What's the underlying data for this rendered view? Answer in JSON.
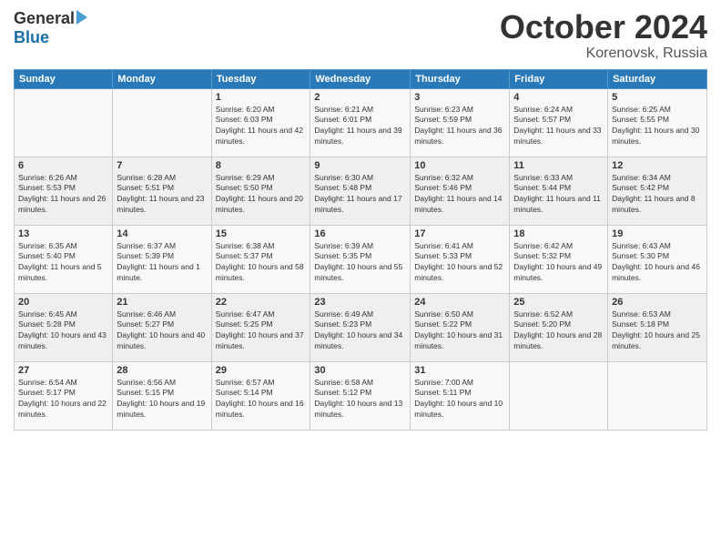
{
  "header": {
    "logo_general": "General",
    "logo_blue": "Blue",
    "month": "October 2024",
    "location": "Korenovsk, Russia"
  },
  "weekdays": [
    "Sunday",
    "Monday",
    "Tuesday",
    "Wednesday",
    "Thursday",
    "Friday",
    "Saturday"
  ],
  "weeks": [
    [
      {
        "day": "",
        "info": ""
      },
      {
        "day": "",
        "info": ""
      },
      {
        "day": "1",
        "info": "Sunrise: 6:20 AM\nSunset: 6:03 PM\nDaylight: 11 hours and 42 minutes."
      },
      {
        "day": "2",
        "info": "Sunrise: 6:21 AM\nSunset: 6:01 PM\nDaylight: 11 hours and 39 minutes."
      },
      {
        "day": "3",
        "info": "Sunrise: 6:23 AM\nSunset: 5:59 PM\nDaylight: 11 hours and 36 minutes."
      },
      {
        "day": "4",
        "info": "Sunrise: 6:24 AM\nSunset: 5:57 PM\nDaylight: 11 hours and 33 minutes."
      },
      {
        "day": "5",
        "info": "Sunrise: 6:25 AM\nSunset: 5:55 PM\nDaylight: 11 hours and 30 minutes."
      }
    ],
    [
      {
        "day": "6",
        "info": "Sunrise: 6:26 AM\nSunset: 5:53 PM\nDaylight: 11 hours and 26 minutes."
      },
      {
        "day": "7",
        "info": "Sunrise: 6:28 AM\nSunset: 5:51 PM\nDaylight: 11 hours and 23 minutes."
      },
      {
        "day": "8",
        "info": "Sunrise: 6:29 AM\nSunset: 5:50 PM\nDaylight: 11 hours and 20 minutes."
      },
      {
        "day": "9",
        "info": "Sunrise: 6:30 AM\nSunset: 5:48 PM\nDaylight: 11 hours and 17 minutes."
      },
      {
        "day": "10",
        "info": "Sunrise: 6:32 AM\nSunset: 5:46 PM\nDaylight: 11 hours and 14 minutes."
      },
      {
        "day": "11",
        "info": "Sunrise: 6:33 AM\nSunset: 5:44 PM\nDaylight: 11 hours and 11 minutes."
      },
      {
        "day": "12",
        "info": "Sunrise: 6:34 AM\nSunset: 5:42 PM\nDaylight: 11 hours and 8 minutes."
      }
    ],
    [
      {
        "day": "13",
        "info": "Sunrise: 6:35 AM\nSunset: 5:40 PM\nDaylight: 11 hours and 5 minutes."
      },
      {
        "day": "14",
        "info": "Sunrise: 6:37 AM\nSunset: 5:39 PM\nDaylight: 11 hours and 1 minute."
      },
      {
        "day": "15",
        "info": "Sunrise: 6:38 AM\nSunset: 5:37 PM\nDaylight: 10 hours and 58 minutes."
      },
      {
        "day": "16",
        "info": "Sunrise: 6:39 AM\nSunset: 5:35 PM\nDaylight: 10 hours and 55 minutes."
      },
      {
        "day": "17",
        "info": "Sunrise: 6:41 AM\nSunset: 5:33 PM\nDaylight: 10 hours and 52 minutes."
      },
      {
        "day": "18",
        "info": "Sunrise: 6:42 AM\nSunset: 5:32 PM\nDaylight: 10 hours and 49 minutes."
      },
      {
        "day": "19",
        "info": "Sunrise: 6:43 AM\nSunset: 5:30 PM\nDaylight: 10 hours and 46 minutes."
      }
    ],
    [
      {
        "day": "20",
        "info": "Sunrise: 6:45 AM\nSunset: 5:28 PM\nDaylight: 10 hours and 43 minutes."
      },
      {
        "day": "21",
        "info": "Sunrise: 6:46 AM\nSunset: 5:27 PM\nDaylight: 10 hours and 40 minutes."
      },
      {
        "day": "22",
        "info": "Sunrise: 6:47 AM\nSunset: 5:25 PM\nDaylight: 10 hours and 37 minutes."
      },
      {
        "day": "23",
        "info": "Sunrise: 6:49 AM\nSunset: 5:23 PM\nDaylight: 10 hours and 34 minutes."
      },
      {
        "day": "24",
        "info": "Sunrise: 6:50 AM\nSunset: 5:22 PM\nDaylight: 10 hours and 31 minutes."
      },
      {
        "day": "25",
        "info": "Sunrise: 6:52 AM\nSunset: 5:20 PM\nDaylight: 10 hours and 28 minutes."
      },
      {
        "day": "26",
        "info": "Sunrise: 6:53 AM\nSunset: 5:18 PM\nDaylight: 10 hours and 25 minutes."
      }
    ],
    [
      {
        "day": "27",
        "info": "Sunrise: 6:54 AM\nSunset: 5:17 PM\nDaylight: 10 hours and 22 minutes."
      },
      {
        "day": "28",
        "info": "Sunrise: 6:56 AM\nSunset: 5:15 PM\nDaylight: 10 hours and 19 minutes."
      },
      {
        "day": "29",
        "info": "Sunrise: 6:57 AM\nSunset: 5:14 PM\nDaylight: 10 hours and 16 minutes."
      },
      {
        "day": "30",
        "info": "Sunrise: 6:58 AM\nSunset: 5:12 PM\nDaylight: 10 hours and 13 minutes."
      },
      {
        "day": "31",
        "info": "Sunrise: 7:00 AM\nSunset: 5:11 PM\nDaylight: 10 hours and 10 minutes."
      },
      {
        "day": "",
        "info": ""
      },
      {
        "day": "",
        "info": ""
      }
    ]
  ]
}
